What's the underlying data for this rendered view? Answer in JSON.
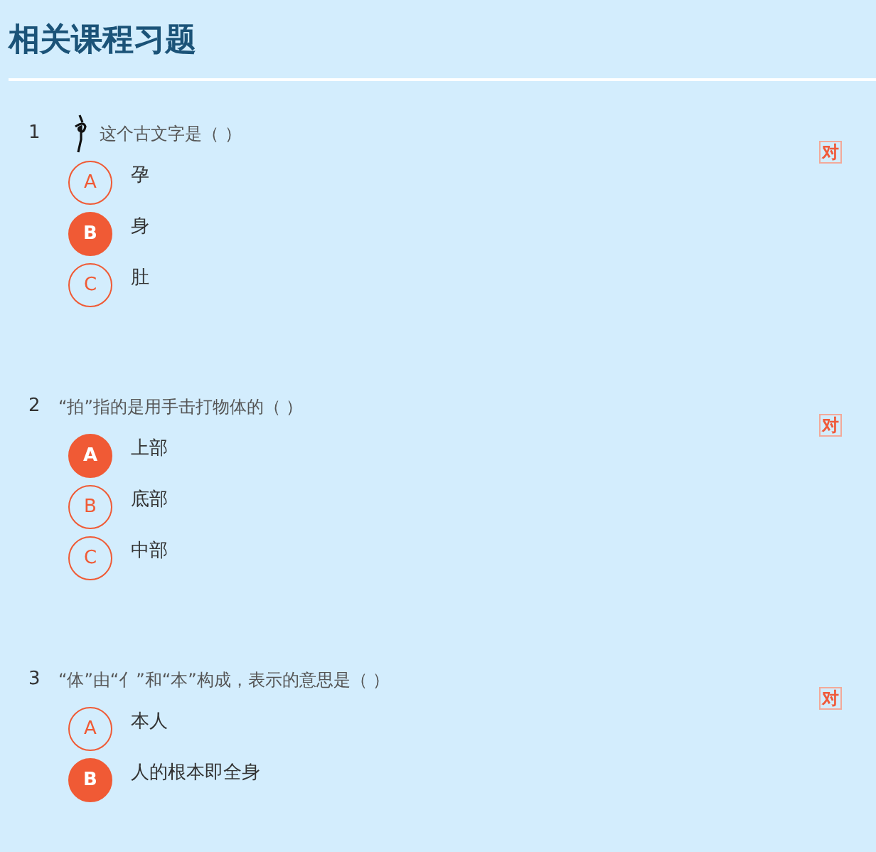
{
  "title": "相关课程习题",
  "questions": [
    {
      "number": "1",
      "has_glyph": true,
      "text": "这个古文字是（ ）",
      "result": "对",
      "options": [
        {
          "letter": "A",
          "text": "孕",
          "selected": false
        },
        {
          "letter": "B",
          "text": "身",
          "selected": true
        },
        {
          "letter": "C",
          "text": "肚",
          "selected": false
        }
      ]
    },
    {
      "number": "2",
      "has_glyph": false,
      "text": "“拍”指的是用手击打物体的（ ）",
      "result": "对",
      "options": [
        {
          "letter": "A",
          "text": "上部",
          "selected": true
        },
        {
          "letter": "B",
          "text": "底部",
          "selected": false
        },
        {
          "letter": "C",
          "text": "中部",
          "selected": false
        }
      ]
    },
    {
      "number": "3",
      "has_glyph": false,
      "text": "“体”由“亻”和“本”构成，表示的意思是（ ）",
      "result": "对",
      "options": [
        {
          "letter": "A",
          "text": "本人",
          "selected": false
        },
        {
          "letter": "B",
          "text": "人的根本即全身",
          "selected": true
        }
      ]
    }
  ]
}
